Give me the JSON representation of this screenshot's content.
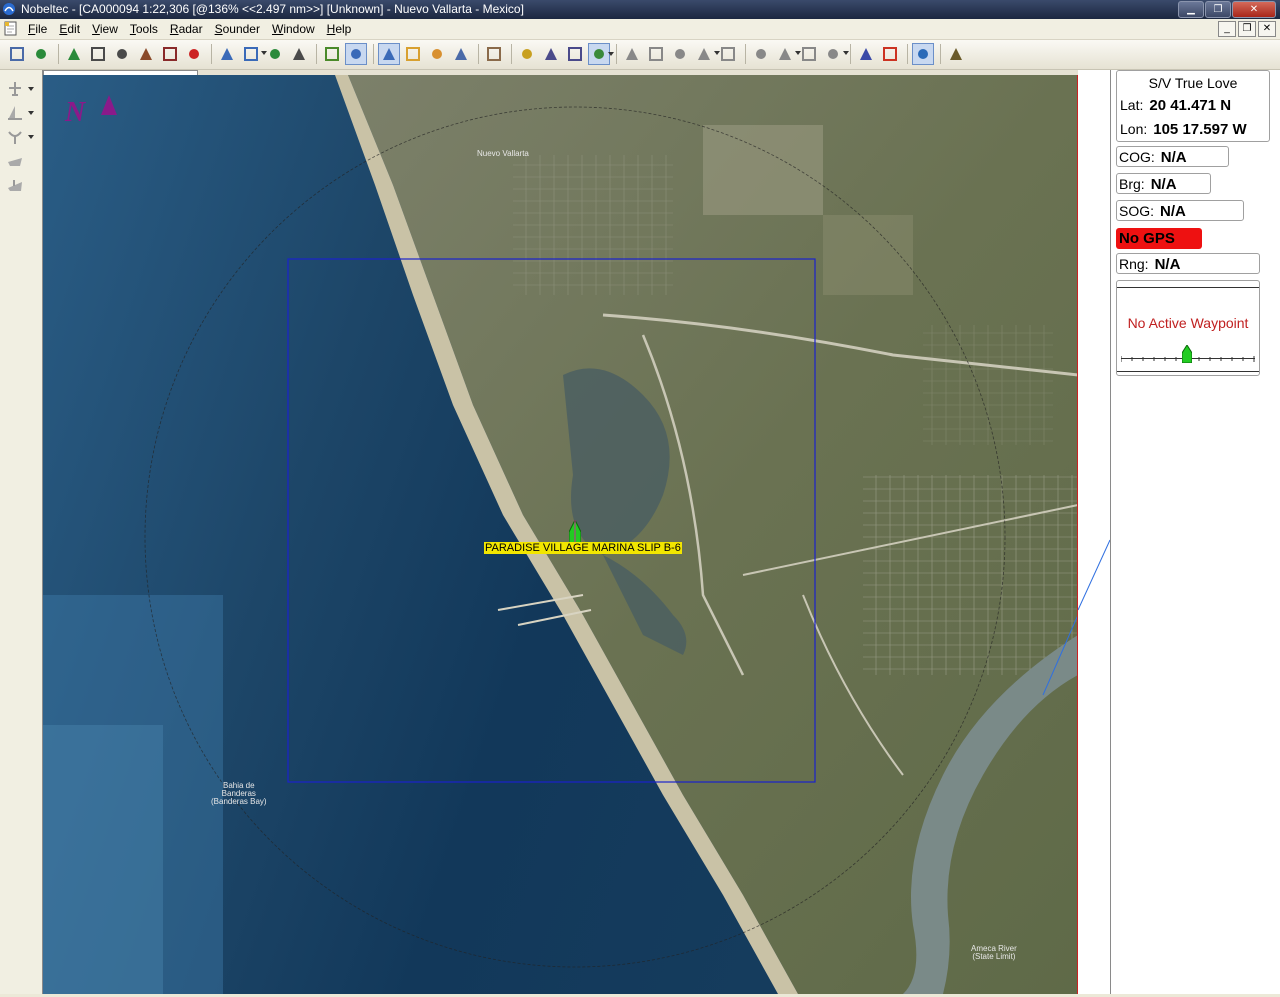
{
  "window": {
    "title": "Nobeltec - [CA000094 1:22,306 [@136% <<2.497 nm>>] [Unknown] - Nuevo Vallarta - Mexico]",
    "buttons": [
      "minimize",
      "maximize",
      "close"
    ]
  },
  "menu": {
    "items": [
      {
        "label": "File",
        "accel": "F",
        "rest": "ile"
      },
      {
        "label": "Edit",
        "accel": "E",
        "rest": "dit"
      },
      {
        "label": "View",
        "accel": "V",
        "rest": "iew"
      },
      {
        "label": "Tools",
        "accel": "T",
        "rest": "ools"
      },
      {
        "label": "Radar",
        "accel": "R",
        "rest": "adar"
      },
      {
        "label": "Sounder",
        "accel": "S",
        "rest": "ounder"
      },
      {
        "label": "Window",
        "accel": "W",
        "rest": "indow"
      },
      {
        "label": "Help",
        "accel": "H",
        "rest": "elp"
      }
    ]
  },
  "toolbar": {
    "icons": [
      "open-chart-icon",
      "globe-icon",
      "route-tool-icon",
      "ruler-icon",
      "zoom-box-icon",
      "chart-3d-icon",
      "tide-icon",
      "lifering-icon",
      "zoom-out-icon",
      "zoom-in-icon",
      "waypoint-icon",
      "cross-icon",
      "line-tool-icon",
      "circle-tool-icon",
      "note-tool-icon",
      "fish-icon",
      "gear-icon",
      "grid-icon",
      "hand-pan-icon",
      "check-icon",
      "chart-list-icon",
      "chart-select-icon",
      "layers-icon",
      "page-icon",
      "page-copy-icon",
      "page-edit-icon",
      "page-add-icon",
      "page-delete-icon",
      "target-icon",
      "target-settings-icon",
      "arrow-route-icon",
      "arrow-route2-icon",
      "building-icon",
      "plane-icon",
      "pointer-icon",
      "lantern-icon"
    ]
  },
  "chart": {
    "north_label": "N",
    "marina_label": "PARADISE VILLAGE MARINA SLIP B-6",
    "map_labels": [
      {
        "text": "Nuevo Vallarta"
      },
      {
        "text": "Bahia de\nBanderas\n(Banderas Bay)"
      },
      {
        "text": "Ameca River\n(State Limit)"
      }
    ]
  },
  "vessel": {
    "name": "S/V True Love",
    "lat_label": "Lat:",
    "lat_value": "20 41.471 N",
    "lon_label": "Lon:",
    "lon_value": "105 17.597 W"
  },
  "nav": {
    "cog_label": "COG:",
    "cog_value": "N/A",
    "brg_label": "Brg:",
    "brg_value": "N/A",
    "sog_label": "SOG:",
    "sog_value": "N/A",
    "gps_status": "No GPS",
    "rng_label": "Rng:",
    "rng_value": "N/A",
    "waypoint_message": "No Active Waypoint"
  },
  "colors": {
    "gps_alert": "#ee1111",
    "waypoint_text": "#c02020",
    "marina_label_bg": "#f2e600",
    "north_arrow": "#8a1a8a"
  }
}
